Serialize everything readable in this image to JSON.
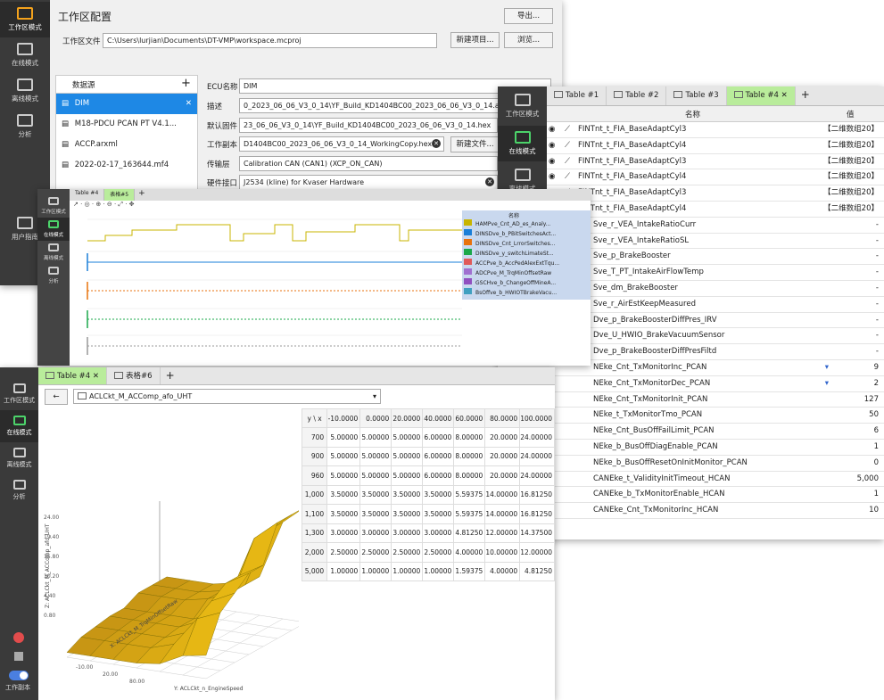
{
  "colors": {
    "sidebar": "#3a3a3a",
    "active_tab": "#b9ec9b",
    "accent_green": "#4cd36a",
    "accent_orange": "#f4a21c",
    "chart_yellow": "#c8b400",
    "chart_blue": "#1a7fd8",
    "chart_orange": "#e8720c",
    "chart_green": "#1aa84a"
  },
  "workspace_window": {
    "sidebar": {
      "items": [
        {
          "label": "工作区模式",
          "icon": "workspace-icon"
        },
        {
          "label": "在线模式",
          "icon": "online-icon"
        },
        {
          "label": "离线模式",
          "icon": "offline-icon"
        },
        {
          "label": "分析",
          "icon": "analysis-icon"
        },
        {
          "label": "用户指南",
          "icon": "help-icon"
        }
      ]
    },
    "title": "工作区配置",
    "export_label": "导出...",
    "workspace_file_label": "工作区文件",
    "workspace_file_value": "C:\\Users\\lurjian\\Documents\\DT-VMP\\workspace.mcproj",
    "new_project_label": "新建项目...",
    "browse_label": "浏览...",
    "datasource_header": "数据源",
    "add_label": "+",
    "datasources": [
      "DIM",
      "M18-PDCU PCAN PT V4.1...",
      "ACCP.arxml",
      "2022-02-17_163644.mf4"
    ],
    "ecu_name_label": "ECU名称",
    "ecu_name_value": "DIM",
    "desc_label": "描述",
    "desc_value": "0_2023_06_06_V3_0_14\\YF_Build_KD1404BC00_2023_06_06_V3_0_14.a2l",
    "default_fw_label": "默认固件",
    "default_fw_value": "23_06_06_V3_0_14\\YF_Build_KD1404BC00_2023_06_06_V3_0_14.hex",
    "work_copy_label": "工作副本",
    "work_copy_value": "D1404BC00_2023_06_06_V3_0_14_WorkingCopy.hex",
    "new_file_label": "新建文件...",
    "transport_label": "传输层",
    "transport_value": "Calibration CAN (CAN1) (XCP_ON_CAN)",
    "hw_label": "硬件接口",
    "hw_value": "J2534 (kline) for Kvaser Hardware"
  },
  "table_window": {
    "sidebar": [
      {
        "label": "工作区模式"
      },
      {
        "label": "在线模式"
      },
      {
        "label": "离线模式"
      }
    ],
    "tabs": [
      "Table #1",
      "Table #2",
      "Table #3",
      "Table #4"
    ],
    "add_tab": "+",
    "col_name": "名称",
    "col_value": "值",
    "rows": [
      {
        "name": "FINTnt_t_FIA_BaseAdaptCyl3",
        "value": "【二维数组20】",
        "icon": "curve"
      },
      {
        "name": "FINTnt_t_FIA_BaseAdaptCyl4",
        "value": "【二维数组20】",
        "icon": "curve"
      },
      {
        "name": "FINTnt_t_FIA_BaseAdaptCyl3",
        "value": "【二维数组20】",
        "icon": "curve"
      },
      {
        "name": "FINTnt_t_FIA_BaseAdaptCyl4",
        "value": "【二维数组20】",
        "icon": "curve"
      },
      {
        "name": "FINTnt_t_FIA_BaseAdaptCyl3",
        "value": "【二维数组20】",
        "icon": "curve"
      },
      {
        "name": "FINTnt_t_FIA_BaseAdaptCyl4",
        "value": "【二维数组20】",
        "icon": "curve"
      },
      {
        "name": "Sve_r_VEA_IntakeRatioCurr",
        "value": "-",
        "icon": "hash"
      },
      {
        "name": "Sve_r_VEA_IntakeRatioSL",
        "value": "-",
        "icon": "hash"
      },
      {
        "name": "Sve_p_BrakeBooster",
        "value": "-",
        "icon": "hash"
      },
      {
        "name": "Sve_T_PT_IntakeAirFlowTemp",
        "value": "-",
        "icon": "hash"
      },
      {
        "name": "Sve_dm_BrakeBooster",
        "value": "-",
        "icon": "hash"
      },
      {
        "name": "Sve_r_AirEstKeepMeasured",
        "value": "-",
        "icon": "hash"
      },
      {
        "name": "Dve_p_BrakeBoosterDiffPres_IRV",
        "value": "-",
        "icon": "hash"
      },
      {
        "name": "Dve_U_HWIO_BrakeVacuumSensor",
        "value": "-",
        "icon": "hash"
      },
      {
        "name": "Dve_p_BrakeBoosterDiffPresFiltd",
        "value": "-",
        "icon": "hash"
      },
      {
        "name": "NEke_Cnt_TxMonitorInc_PCAN",
        "value": "9",
        "icon": "hash"
      },
      {
        "name": "NEke_Cnt_TxMonitorDec_PCAN",
        "value": "2",
        "icon": "hash"
      },
      {
        "name": "NEke_Cnt_TxMonitorInit_PCAN",
        "value": "127",
        "icon": "hash"
      },
      {
        "name": "NEke_t_TxMonitorTmo_PCAN",
        "value": "50",
        "icon": "hash"
      },
      {
        "name": "NEke_Cnt_BusOffFailLimit_PCAN",
        "value": "6",
        "icon": "hash"
      },
      {
        "name": "NEke_b_BusOffDiagEnable_PCAN",
        "value": "1",
        "icon": "hash"
      },
      {
        "name": "NEke_b_BusOffResetOnInitMonitor_PCAN",
        "value": "0",
        "icon": "hash"
      },
      {
        "name": "CANEke_t_ValidityInitTimeout_HCAN",
        "value": "5,000",
        "icon": "hash"
      },
      {
        "name": "CANEke_b_TxMonitorEnable_HCAN",
        "value": "1",
        "icon": "hash"
      },
      {
        "name": "CANEke_Cnt_TxMonitorInc_HCAN",
        "value": "10",
        "icon": "hash"
      }
    ]
  },
  "scope_window": {
    "tabs": [
      "Table #4",
      "表格#5"
    ],
    "add_tab": "+",
    "sidebar": [
      "工作区模式",
      "在线模式",
      "离线模式",
      "分析"
    ],
    "legend_header": "名称",
    "signals": [
      {
        "name": "HAMPve_Cnt_AD_es_Analy...",
        "color": "#c8b400"
      },
      {
        "name": "DINSDve_b_PBitSwitchesAct...",
        "color": "#1a7fd8"
      },
      {
        "name": "DINSDve_Cnt_LrrorSwitches...",
        "color": "#e8720c"
      },
      {
        "name": "DINSDve_y_switchLimateSt...",
        "color": "#1aa84a"
      },
      {
        "name": "ACCPve_b_AccPedAlexExtTqu...",
        "color": "#e05a5a"
      },
      {
        "name": "ADCPve_M_TrqMinOffsetRaw",
        "color": "#a070d0"
      },
      {
        "name": "GSCHve_b_ChangeOffMineA...",
        "color": "#9050c0"
      },
      {
        "name": "BsOffve_b_HWIOTBrakeVacu...",
        "color": "#40a0c0"
      }
    ]
  },
  "map_window": {
    "sidebar": [
      {
        "label": "工作区模式"
      },
      {
        "label": "在线模式"
      },
      {
        "label": "离线模式"
      },
      {
        "label": "分析"
      },
      {
        "label": "工作副本"
      }
    ],
    "tabs": [
      "Table #4",
      "表格#6"
    ],
    "add_tab": "+",
    "back_label": "←",
    "map_name": "ACLCkt_M_ACComp_afo_UHT",
    "corner_label": "y \\ x",
    "x_axis": [
      "-10.0000",
      "0.0000",
      "20.0000",
      "40.0000",
      "60.0000",
      "80.0000",
      "100.0000"
    ],
    "y_axis": [
      "700",
      "900",
      "960",
      "1,000",
      "1,100",
      "1,300",
      "2,000",
      "5,000"
    ],
    "cells": [
      [
        "5.00000",
        "5.00000",
        "5.00000",
        "6.00000",
        "8.00000",
        "20.0000",
        "24.00000"
      ],
      [
        "5.00000",
        "5.00000",
        "5.00000",
        "6.00000",
        "8.00000",
        "20.0000",
        "24.00000"
      ],
      [
        "5.00000",
        "5.00000",
        "5.00000",
        "6.00000",
        "8.00000",
        "20.0000",
        "24.00000"
      ],
      [
        "3.50000",
        "3.50000",
        "3.50000",
        "3.50000",
        "5.59375",
        "14.00000",
        "16.81250"
      ],
      [
        "3.50000",
        "3.50000",
        "3.50000",
        "3.50000",
        "5.59375",
        "14.00000",
        "16.81250"
      ],
      [
        "3.00000",
        "3.00000",
        "3.00000",
        "3.00000",
        "4.81250",
        "12.00000",
        "14.37500"
      ],
      [
        "2.50000",
        "2.50000",
        "2.50000",
        "2.50000",
        "4.00000",
        "10.00000",
        "12.00000"
      ],
      [
        "1.00000",
        "1.00000",
        "1.00000",
        "1.00000",
        "1.59375",
        "4.00000",
        "4.81250"
      ]
    ],
    "z_ticks": [
      "24.00",
      "19.40",
      "15.80",
      "10.20",
      "4.40",
      "0.80"
    ],
    "z_label": "Z: ACLCkt_M_ACComp_afo_UHT",
    "x3d_label": "X: ACLCkt_M_TrqMinOffsetRaw",
    "y3d_label": "Y: ACLCkt_n_EngineSpeed",
    "x3d_ticks": [
      "-10.00",
      "20.00",
      "80.00"
    ]
  }
}
